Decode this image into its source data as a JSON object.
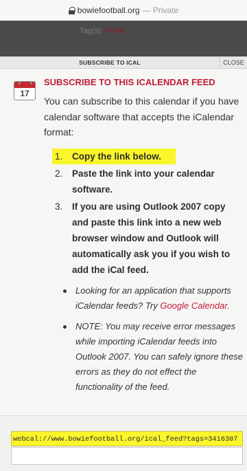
{
  "browser": {
    "domain": "bowiefootball.org",
    "separator": "—",
    "mode": "Private"
  },
  "site": {
    "tags_label": "Tag(s):",
    "tags_value": "Home"
  },
  "tabs": {
    "subscribe": "SUBSCRIBE TO ICAL",
    "close": "CLOSE"
  },
  "content": {
    "calendar_icon_day": "17",
    "title": "SUBSCRIBE TO THIS ICALENDAR FEED",
    "intro": "You can subscribe to this calendar if you have calendar software that accepts the iCalendar format:",
    "steps": [
      {
        "num": "1.",
        "text": "Copy the link below."
      },
      {
        "num": "2.",
        "text": "Paste the link into your calendar software."
      },
      {
        "num": "3.",
        "text": "If you are using Outlook 2007 copy and paste this link into a new web browser window and Outlook will automatically ask you if you wish to add the iCal feed."
      }
    ],
    "notes": [
      {
        "text": "Looking for an application that supports iCalendar feeds? Try ",
        "link": "Google Calendar",
        "after": "."
      },
      {
        "text": "NOTE: You may receive error messages while importing iCalendar feeds into Outlook 2007. You can safely ignore these errors as they do not effect the functionality of the feed."
      }
    ]
  },
  "footer": {
    "feed_url": "webcal://www.bowiefootball.org/ical_feed?tags=3416307",
    "input_value": ""
  },
  "colors": {
    "accent": "#c01b3a",
    "highlight": "#fbf52b",
    "header_bg": "#4a4a4a"
  }
}
